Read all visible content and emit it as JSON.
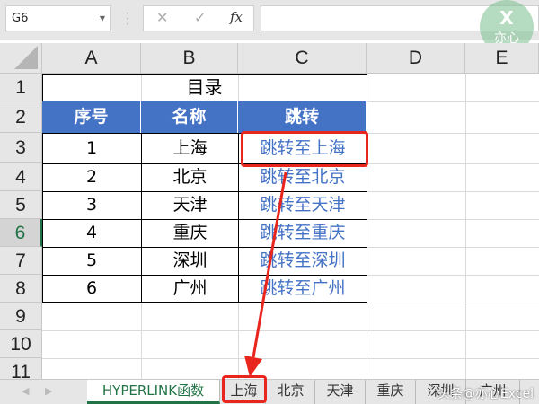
{
  "formula_bar": {
    "name_box": "G6",
    "cancel_icon": "✕",
    "enter_icon": "✓",
    "fx_label": "fx",
    "formula": ""
  },
  "columns": [
    "A",
    "B",
    "C",
    "D",
    "E"
  ],
  "rows": [
    "1",
    "2",
    "3",
    "4",
    "5",
    "6",
    "7",
    "8",
    "9",
    "10",
    "11"
  ],
  "selected_row": "6",
  "table": {
    "title": "目录",
    "headers": [
      "序号",
      "名称",
      "跳转"
    ],
    "rows": [
      [
        "1",
        "上海",
        "跳转至上海"
      ],
      [
        "2",
        "北京",
        "跳转至北京"
      ],
      [
        "3",
        "天津",
        "跳转至天津"
      ],
      [
        "4",
        "重庆",
        "跳转至重庆"
      ],
      [
        "5",
        "深圳",
        "跳转至深圳"
      ],
      [
        "6",
        "广州",
        "跳转至广州"
      ]
    ]
  },
  "sheet_tabs": [
    "HYPERLINK函数",
    "上海",
    "北京",
    "天津",
    "重庆",
    "深圳",
    "广州"
  ],
  "active_tab": "HYPERLINK函数",
  "logo": {
    "text": "亦心",
    "letter": "X"
  },
  "watermark": "头条@亦心Excel",
  "colors": {
    "header_blue": "#4472c4",
    "accent_green": "#217346",
    "annotation_red": "#e8261e"
  }
}
